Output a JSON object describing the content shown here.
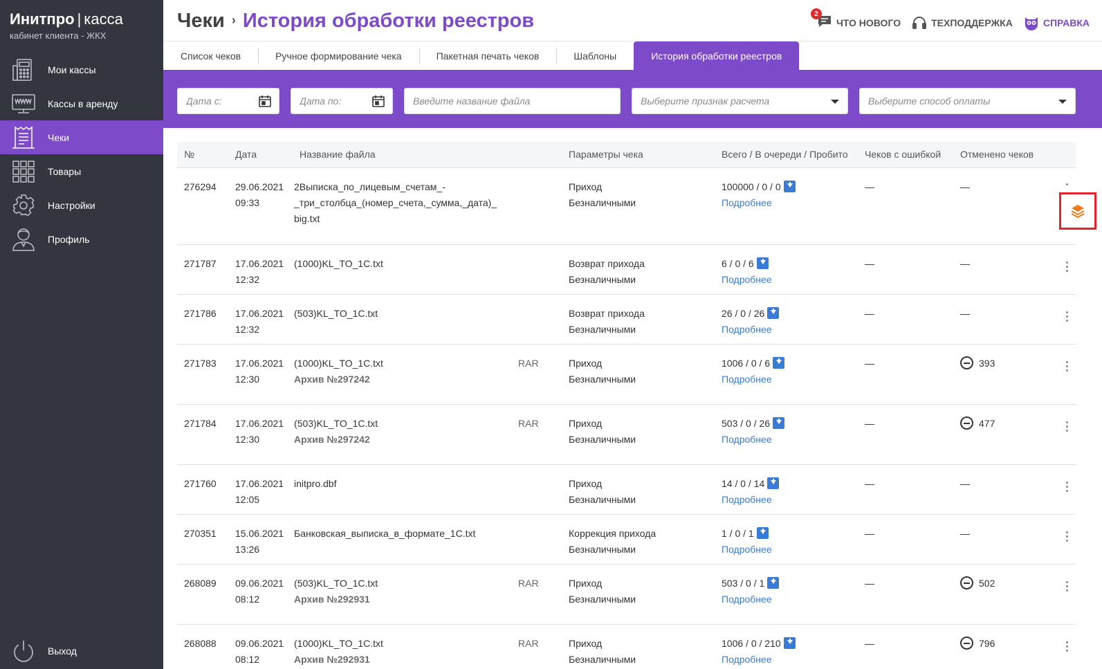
{
  "brand": {
    "name": "Инитпро",
    "separator": "|",
    "product": "касса",
    "subtitle": "кабинет клиента - ЖКХ"
  },
  "sidebar": {
    "items": [
      {
        "label": "Мои кассы",
        "icon": "cash-register-icon"
      },
      {
        "label": "Кассы в аренду",
        "icon": "www-monitor-icon"
      },
      {
        "label": "Чеки",
        "icon": "receipt-icon",
        "active": true
      },
      {
        "label": "Товары",
        "icon": "grid-icon"
      },
      {
        "label": "Настройки",
        "icon": "gear-icon"
      },
      {
        "label": "Профиль",
        "icon": "user-icon"
      }
    ],
    "logout": "Выход"
  },
  "header": {
    "breadcrumb_root": "Чеки",
    "breadcrumb_sep": "›",
    "page_title": "История обработки реестров",
    "links": {
      "news": "ЧТО НОВОГО",
      "news_badge": "2",
      "support": "ТЕХПОДДЕРЖКА",
      "help": "СПРАВКА"
    }
  },
  "tabs": [
    "Список чеков",
    "Ручное формирование чека",
    "Пакетная печать чеков",
    "Шаблоны",
    "История обработки реестров"
  ],
  "filters": {
    "date_from": "Дата с:",
    "date_to": "Дата по:",
    "file_name": "Введите название файла",
    "calc_sign": "Выберите признак расчета",
    "pay_method": "Выберите способ оплаты"
  },
  "table": {
    "headers": {
      "num": "№",
      "date": "Дата",
      "file": "Название файла",
      "params": "Параметры чека",
      "totals": "Всего / В очереди / Пробито",
      "errors": "Чеков с ошибкой",
      "canceled": "Отменено чеков"
    },
    "details_label": "Подробнее",
    "rows": [
      {
        "num": "276294",
        "date": "29.06.2021",
        "time": "09:33",
        "file1": "2Выписка_по_лицевым_счетам_-",
        "file2": "_три_столбца_(номер_счета,_сумма,_дата)_",
        "file3": "big.txt",
        "type": "",
        "param1": "Приход",
        "param2": "Безналичными",
        "totals": "100000 / 0 / 0",
        "errors": "—",
        "canceled": "—"
      },
      {
        "num": "271787",
        "date": "17.06.2021",
        "time": "12:32",
        "file1": "(1000)KL_TO_1C.txt",
        "file2": "",
        "file3": "",
        "type": "",
        "param1": "Возврат прихода",
        "param2": "Безналичными",
        "totals": "6 / 0 / 6",
        "errors": "—",
        "canceled": "—"
      },
      {
        "num": "271786",
        "date": "17.06.2021",
        "time": "12:32",
        "file1": "(503)KL_TO_1C.txt",
        "file2": "",
        "file3": "",
        "type": "",
        "param1": "Возврат прихода",
        "param2": "Безналичными",
        "totals": "26 / 0 / 26",
        "errors": "—",
        "canceled": "—"
      },
      {
        "num": "271783",
        "date": "17.06.2021",
        "time": "12:30",
        "file1": "(1000)KL_TO_1C.txt",
        "file2": "Архив №297242",
        "file3": "",
        "type": "RAR",
        "param1": "Приход",
        "param2": "Безналичными",
        "totals": "1006 / 0 / 6",
        "errors": "—",
        "canceled": "393"
      },
      {
        "num": "271784",
        "date": "17.06.2021",
        "time": "12:30",
        "file1": "(503)KL_TO_1C.txt",
        "file2": "Архив №297242",
        "file3": "",
        "type": "RAR",
        "param1": "Приход",
        "param2": "Безналичными",
        "totals": "503 / 0 / 26",
        "errors": "—",
        "canceled": "477"
      },
      {
        "num": "271760",
        "date": "17.06.2021",
        "time": "12:05",
        "file1": "initpro.dbf",
        "file2": "",
        "file3": "",
        "type": "",
        "param1": "Приход",
        "param2": "Безналичными",
        "totals": "14 / 0 / 14",
        "errors": "—",
        "canceled": "—"
      },
      {
        "num": "270351",
        "date": "15.06.2021",
        "time": "13:26",
        "file1": "Банковская_выписка_в_формате_1С.txt",
        "file2": "",
        "file3": "",
        "type": "",
        "param1": "Коррекция прихода",
        "param2": "Безналичными",
        "totals": "1 / 0 / 1",
        "errors": "—",
        "canceled": "—"
      },
      {
        "num": "268089",
        "date": "09.06.2021",
        "time": "08:12",
        "file1": "(503)KL_TO_1C.txt",
        "file2": "Архив №292931",
        "file3": "",
        "type": "RAR",
        "param1": "Приход",
        "param2": "Безналичными",
        "totals": "503 / 0 / 1",
        "errors": "—",
        "canceled": "502"
      },
      {
        "num": "268088",
        "date": "09.06.2021",
        "time": "08:12",
        "file1": "(1000)KL_TO_1C.txt",
        "file2": "Архив №292931",
        "file3": "",
        "type": "RAR",
        "param1": "Приход",
        "param2": "Безналичными",
        "totals": "1006 / 0 / 210",
        "errors": "—",
        "canceled": "796"
      }
    ]
  },
  "colors": {
    "accent": "#7d4bc9",
    "sidebar": "#33363f",
    "link": "#3a7bd5",
    "highlight": "#e3232b",
    "layers_icon": "#f07d1a"
  }
}
